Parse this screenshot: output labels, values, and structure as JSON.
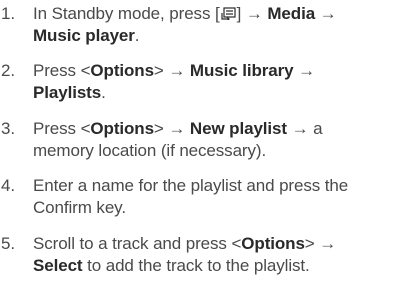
{
  "steps": [
    {
      "number": "1.",
      "parts": [
        "In Standby mode, press [",
        "] → ",
        "Media",
        " →",
        "Music player",
        "."
      ],
      "icon": "menu-key-icon"
    },
    {
      "number": "2.",
      "parts": [
        "Press <",
        "Options",
        "> → ",
        "Music library",
        " →",
        "Playlists",
        "."
      ]
    },
    {
      "number": "3.",
      "parts": [
        "Press <",
        "Options",
        "> → ",
        "New playlist",
        " → a",
        "memory location (if necessary)."
      ]
    },
    {
      "number": "4.",
      "parts": [
        "Enter a name for the playlist and press the",
        "Confirm key."
      ]
    },
    {
      "number": "5.",
      "parts": [
        "Scroll to a track and press <",
        "Options",
        "> →",
        "Select",
        " to add the track to the playlist."
      ]
    }
  ]
}
